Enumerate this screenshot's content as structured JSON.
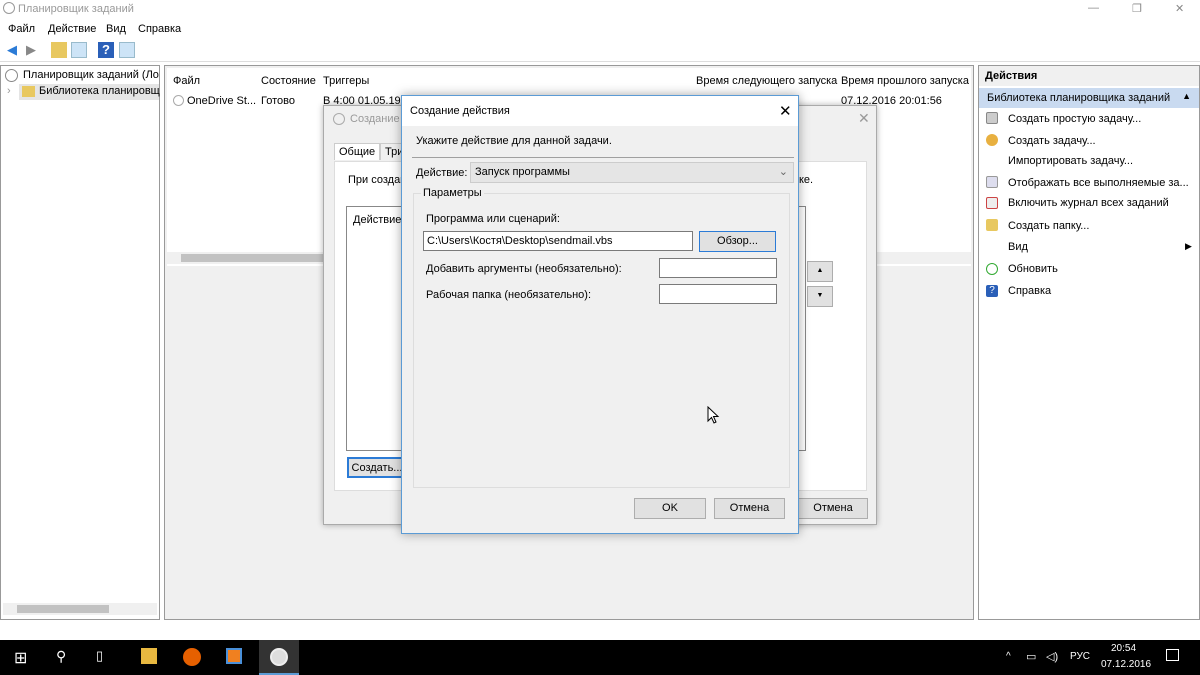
{
  "window": {
    "title": "Планировщик заданий",
    "minimize": "—",
    "maximize": "❐",
    "close": "✕"
  },
  "menu": [
    "Файл",
    "Действие",
    "Вид",
    "Справка"
  ],
  "tree": {
    "root": "Планировщик заданий (Лок",
    "library": "Библиотека планировщ"
  },
  "table": {
    "headers": [
      "Файл",
      "Состояние",
      "Триггеры",
      "Время следующего запуска",
      "Время прошлого запуска"
    ],
    "rows": [
      {
        "name": "OneDrive St...",
        "state": "Готово",
        "trigger": "В 4:00 01.05.1992",
        "next": "",
        "last": "07.12.2016 20:01:56"
      }
    ]
  },
  "actions": {
    "title": "Действия",
    "section": "Библиотека планировщика заданий",
    "items": [
      "Создать простую задачу...",
      "Создать задачу...",
      "Импортировать задачу...",
      "Отображать все выполняемые за...",
      "Включить журнал всех заданий",
      "Создать папку...",
      "Вид",
      "Обновить",
      "Справка"
    ]
  },
  "back_dialog": {
    "title": "Создание з",
    "tabs": [
      "Общие",
      "Три"
    ],
    "text_left": "При создан",
    "text_right": "ке.",
    "list_header": "Действие",
    "create_btn": "Создать...",
    "cancel_btn": "Отмена",
    "up": "▲",
    "down": "▼"
  },
  "dialog": {
    "title": "Создание действия",
    "instruction": "Укажите действие для данной задачи.",
    "action_label": "Действие:",
    "action_value": "Запуск программы",
    "group": "Параметры",
    "program_label": "Программа или сценарий:",
    "program_value": "C:\\Users\\Костя\\Desktop\\sendmail.vbs",
    "browse": "Обзор...",
    "args_label": "Добавить аргументы (необязательно):",
    "args_value": "",
    "workdir_label": "Рабочая папка (необязательно):",
    "workdir_value": "",
    "ok": "OK",
    "cancel": "Отмена"
  },
  "taskbar": {
    "time": "20:54",
    "date": "07.12.2016",
    "lang": "РУС"
  },
  "colors": {
    "accent": "#2b7bd6",
    "taskbar": "#000000",
    "dialog_border": "#5b9bd5"
  }
}
